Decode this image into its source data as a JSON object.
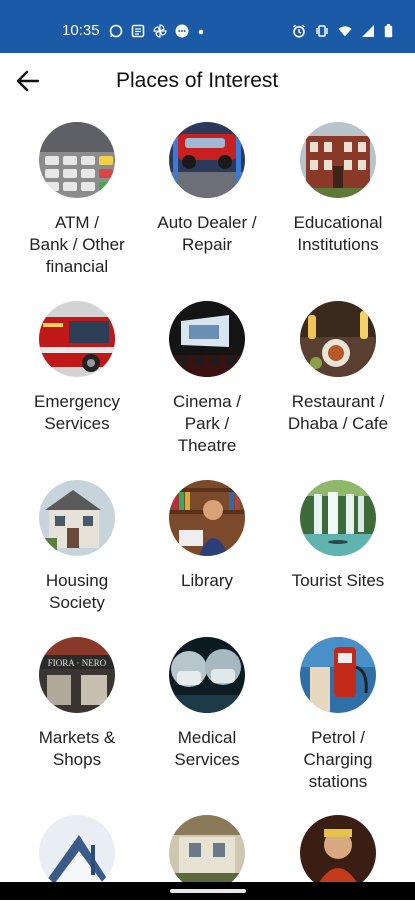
{
  "status_bar": {
    "time": "10:35",
    "left_icons": [
      "whatsapp-icon",
      "news-icon",
      "pinwheel-icon",
      "chat-bubble-icon",
      "dot-icon"
    ],
    "right_icons": [
      "alarm-icon",
      "vibrate-icon",
      "wifi-icon",
      "signal-icon",
      "battery-icon"
    ],
    "background": "#1b5aa6"
  },
  "app_bar": {
    "title": "Places of Interest",
    "back_icon": "arrow-left-icon"
  },
  "categories": [
    {
      "label": "ATM /\nBank / Other\nfinancial"
    },
    {
      "label": "Auto Dealer /\nRepair"
    },
    {
      "label": "Educational\nInstitutions"
    },
    {
      "label": "Emergency\nServices"
    },
    {
      "label": "Cinema /\nPark /\nTheatre"
    },
    {
      "label": "Restaurant /\nDhaba / Cafe"
    },
    {
      "label": "Housing\nSociety"
    },
    {
      "label": "Library"
    },
    {
      "label": "Tourist Sites"
    },
    {
      "label": "Markets &\nShops"
    },
    {
      "label": "Medical\nServices"
    },
    {
      "label": "Petrol /\nCharging\nstations"
    },
    {
      "label": ""
    },
    {
      "label": ""
    },
    {
      "label": ""
    }
  ]
}
